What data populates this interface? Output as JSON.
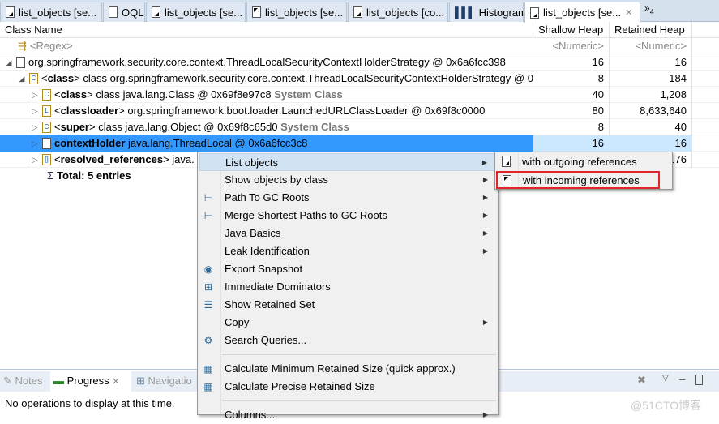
{
  "tabs": [
    {
      "label": "list_objects  [se...",
      "icon": "document-outgoing-icon"
    },
    {
      "label": "OQL",
      "icon": "oql-icon"
    },
    {
      "label": "list_objects  [se...",
      "icon": "document-outgoing-icon"
    },
    {
      "label": "list_objects  [se...",
      "icon": "document-incoming-icon"
    },
    {
      "label": "list_objects  [co...",
      "icon": "document-outgoing-icon"
    },
    {
      "label": "Histogram",
      "icon": "histogram-icon"
    },
    {
      "label": "list_objects  [se...",
      "icon": "document-outgoing-icon",
      "active": true
    }
  ],
  "overflow": {
    "label": "»",
    "count": "4"
  },
  "columns": {
    "name": "Class Name",
    "shallow": "Shallow Heap",
    "retained": "Retained Heap"
  },
  "filter": {
    "name": "<Regex>",
    "shallow": "<Numeric>",
    "retained": "<Numeric>"
  },
  "rows": [
    {
      "pre": "",
      "bold": "",
      "text": "org.springframework.security.core.context.ThreadLocalSecurityContextHolderStrategy @ 0x6a6fcc398",
      "sys": "",
      "shallow": "16",
      "retained": "16"
    },
    {
      "pre": "<",
      "bold": "class",
      "text": "> class org.springframework.security.core.context.ThreadLocalSecurityContextHolderStrategy @ 0",
      "sys": "",
      "shallow": "8",
      "retained": "184"
    },
    {
      "pre": "<",
      "bold": "class",
      "text": "> class java.lang.Class @ 0x69f8e97c8 ",
      "sys": "System Class",
      "shallow": "40",
      "retained": "1,208"
    },
    {
      "pre": "<",
      "bold": "classloader",
      "text": "> org.springframework.boot.loader.LaunchedURLClassLoader @ 0x69f8c0000",
      "sys": "",
      "shallow": "80",
      "retained": "8,633,640"
    },
    {
      "pre": "<",
      "bold": "super",
      "text": "> class java.lang.Object @ 0x69f8c65d0 ",
      "sys": "System Class",
      "shallow": "8",
      "retained": "40"
    },
    {
      "pre": "",
      "bold": "contextHolder",
      "text": " java.lang.ThreadLocal @ 0x6a6fcc3c8",
      "sys": "",
      "shallow": "16",
      "retained": "16"
    },
    {
      "pre": "<",
      "bold": "resolved_references",
      "text": "> java.",
      "sys": "",
      "shallow": "",
      "retained": "176"
    }
  ],
  "total": "Total: 5 entries",
  "bottom": {
    "tabs": [
      "Notes",
      "Progress",
      "Navigatio"
    ],
    "message": "No operations to display at this time.",
    "watermark": "@51CTO博客"
  },
  "menu": [
    {
      "label": "List objects",
      "sub": true
    },
    {
      "label": "Show objects by class",
      "sub": true
    },
    {
      "label": "Path To GC Roots",
      "sub": true
    },
    {
      "label": "Merge Shortest Paths to GC Roots",
      "sub": true
    },
    {
      "label": "Java Basics",
      "sub": true
    },
    {
      "label": "Leak Identification",
      "sub": true
    },
    {
      "label": "Export Snapshot"
    },
    {
      "label": "Immediate Dominators"
    },
    {
      "label": "Show Retained Set"
    },
    {
      "label": "Copy",
      "sub": true
    },
    {
      "label": "Search Queries..."
    },
    {
      "label": "Calculate Minimum Retained Size (quick approx.)"
    },
    {
      "label": "Calculate Precise Retained Size"
    },
    {
      "label": "Columns...",
      "sub": true
    }
  ],
  "submenu": [
    "with outgoing references",
    "with incoming references"
  ],
  "colors": {
    "selection": "#3399ff",
    "highlight_box": "#e0252b",
    "menu_hover": "#d1e2f2"
  }
}
